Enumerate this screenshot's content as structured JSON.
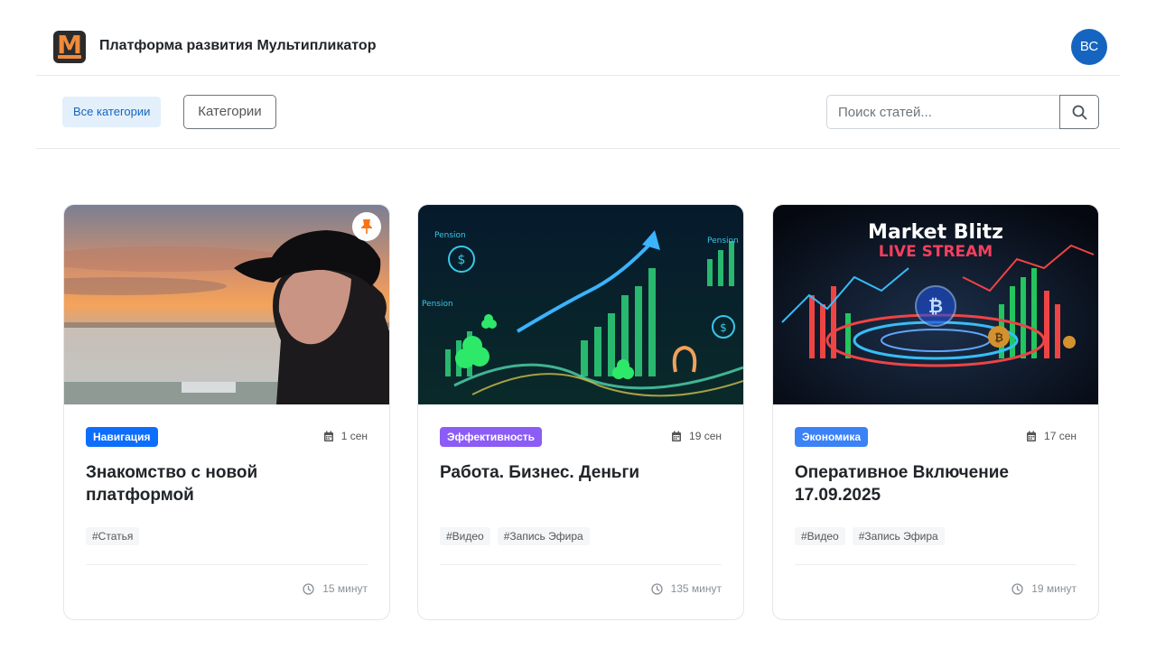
{
  "header": {
    "logo_letter": "M",
    "title": "Платформа развития Мультипликатор",
    "avatar_initials": "ВС"
  },
  "toolbar": {
    "all_categories_label": "Все категории",
    "categories_button_label": "Категории",
    "search_placeholder": "Поиск статей..."
  },
  "colors": {
    "navigation": "#0d6efd",
    "efficiency": "#8b5cf6",
    "economy": "#3b82f6",
    "pin": "#f97316"
  },
  "cards": [
    {
      "category": "Навигация",
      "date": "1 сен",
      "title": "Знакомство с новой платформой",
      "tags": [
        "#Статья"
      ],
      "duration": "15 минут",
      "pinned": true
    },
    {
      "category": "Эффективность",
      "date": "19 сен",
      "title": "Работа. Бизнес. Деньги",
      "tags": [
        "#Видео",
        "#Запись Эфира"
      ],
      "duration": "135 минут",
      "pinned": false,
      "image_labels": [
        "Pension",
        "Pension",
        "Pension"
      ]
    },
    {
      "category": "Экономика",
      "date": "17 сен",
      "title": "Оперативное Включение 17.09.2025",
      "tags": [
        "#Видео",
        "#Запись Эфира"
      ],
      "duration": "19 минут",
      "pinned": false,
      "image_title": "Market Blitz",
      "image_subtitle": "LIVE STREAM"
    }
  ]
}
